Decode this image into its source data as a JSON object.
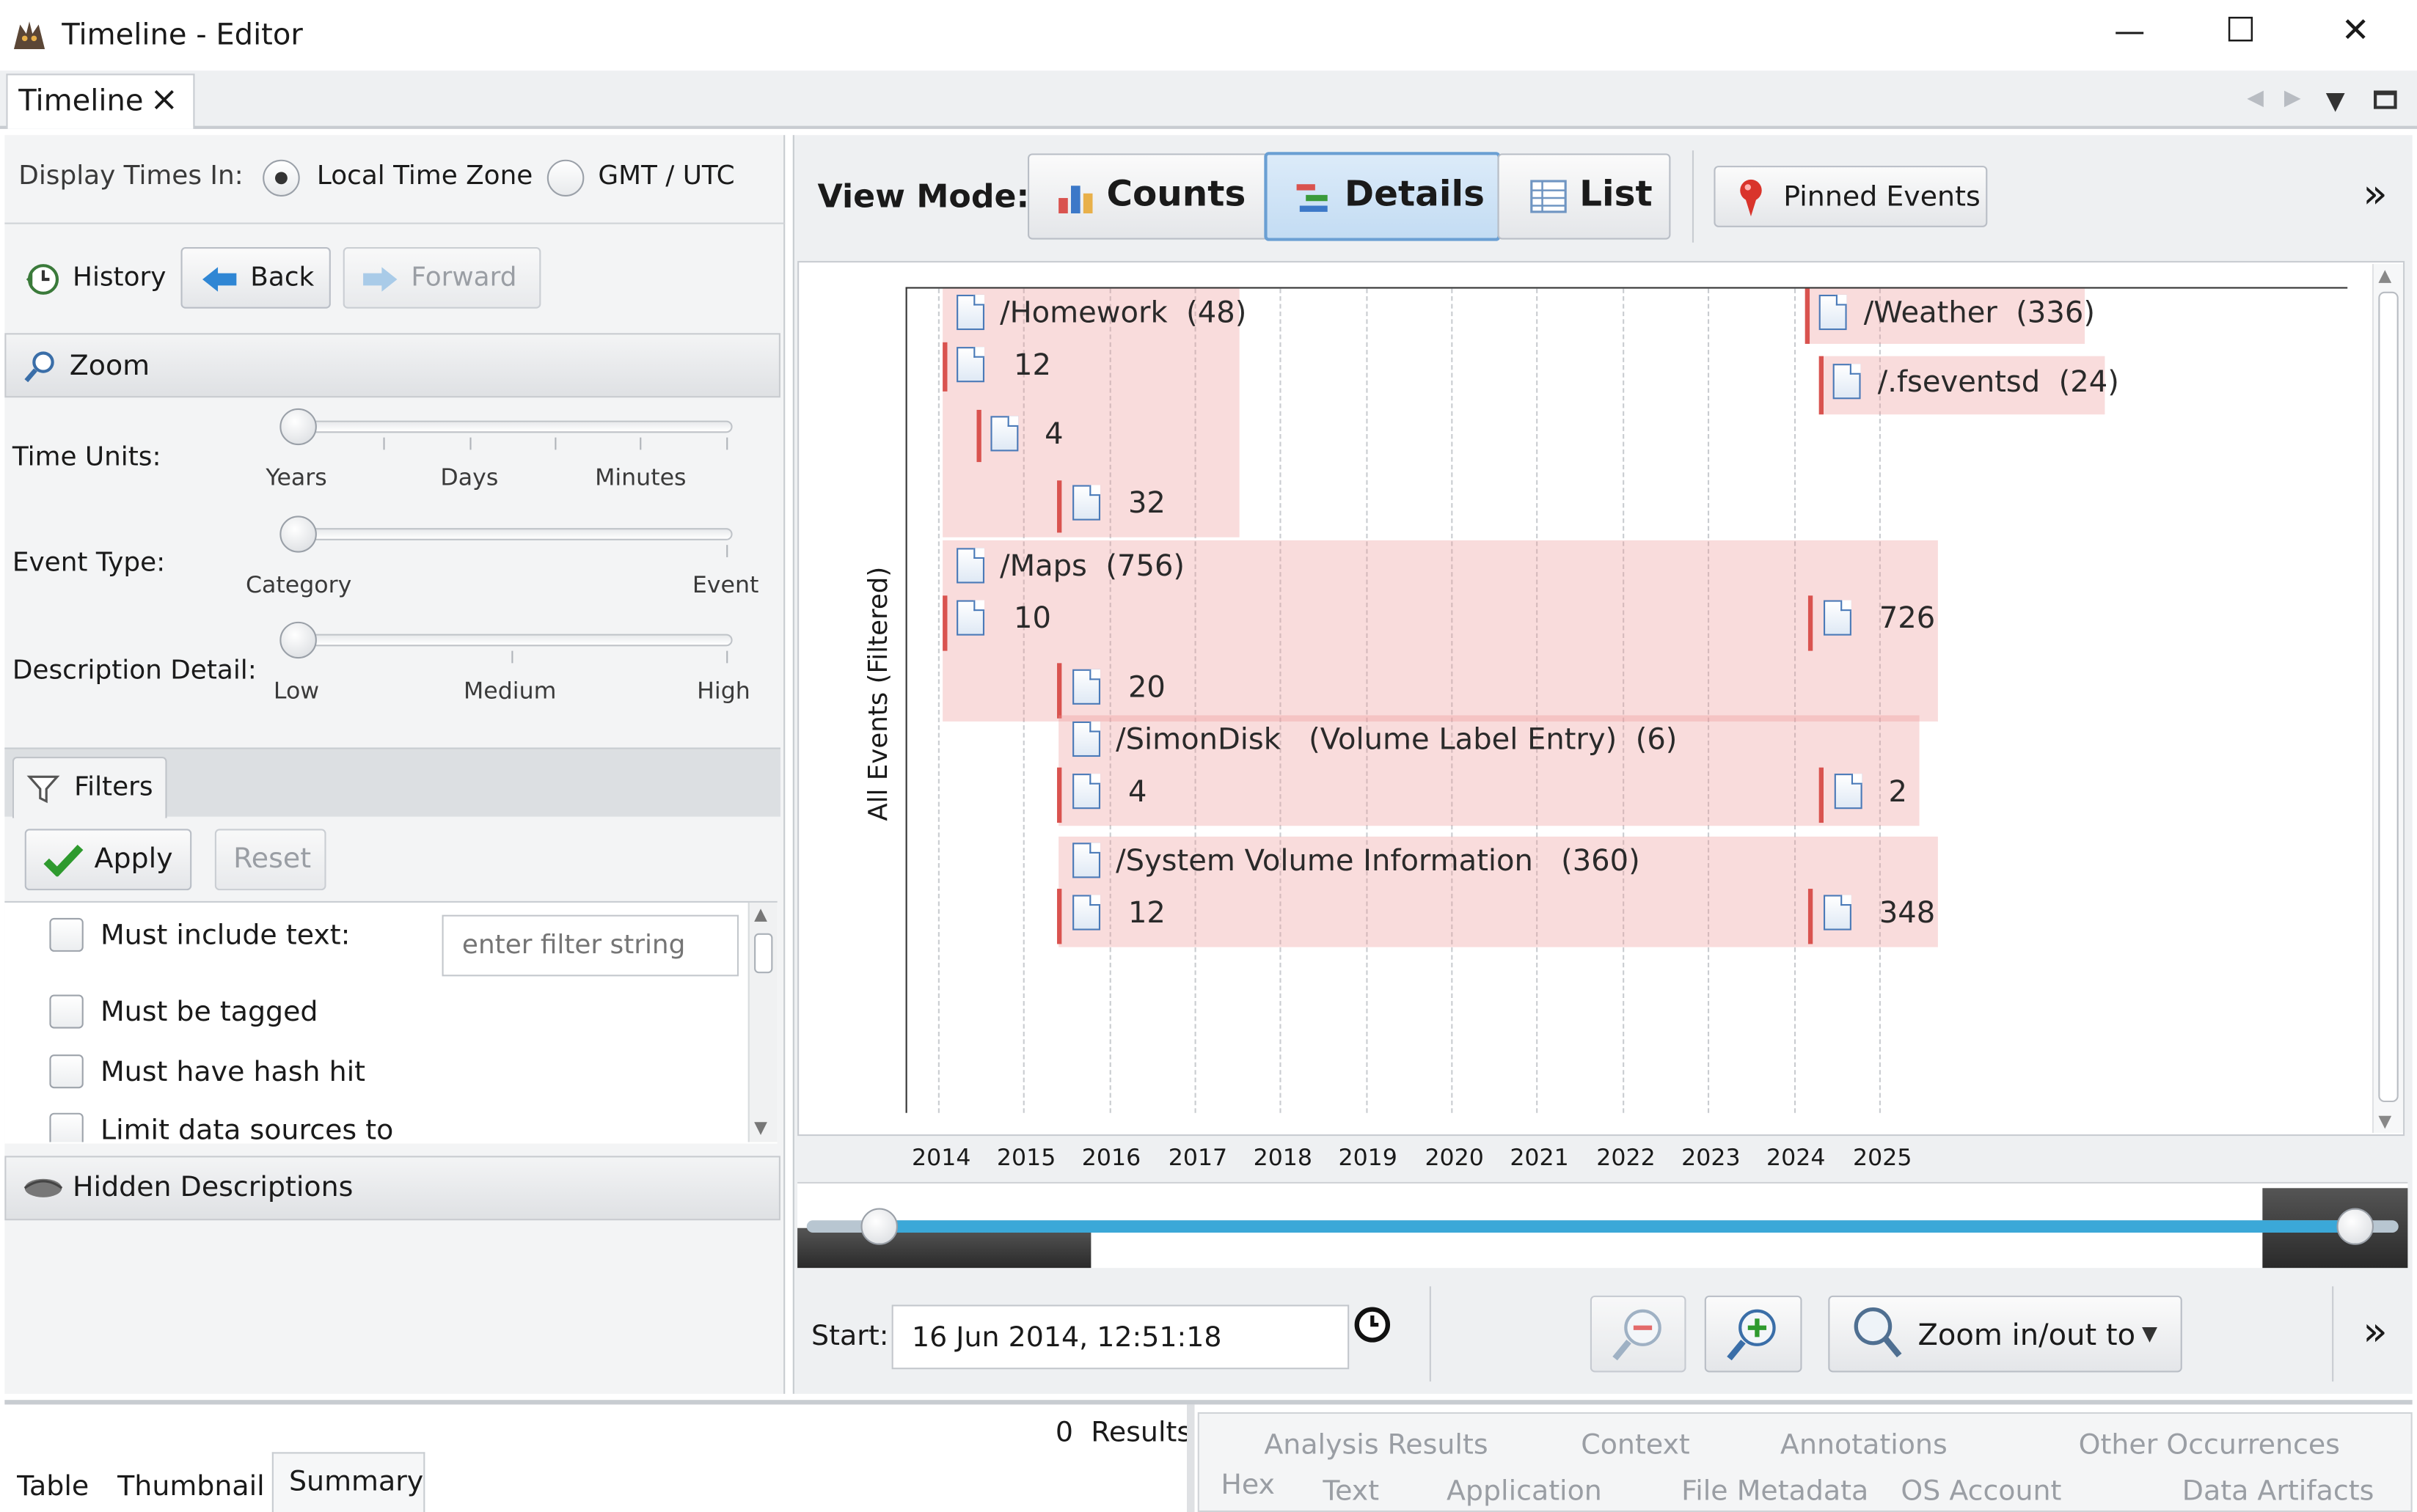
{
  "window": {
    "title": "Timeline - Editor",
    "tab_label": "Timeline",
    "tab_close": "×",
    "min": "—",
    "max": "☐",
    "close": "✕"
  },
  "display_times": {
    "label": "Display Times In:",
    "options": [
      "Local Time Zone",
      "GMT / UTC"
    ],
    "selected": "Local Time Zone"
  },
  "history": {
    "label": "History",
    "back": "Back",
    "forward": "Forward"
  },
  "zoom": {
    "header": "Zoom",
    "time_units": {
      "label": "Time Units:",
      "ticks": [
        "Years",
        "Days",
        "Minutes"
      ],
      "value": "Years"
    },
    "event_type": {
      "label": "Event Type:",
      "ticks": [
        "Category",
        "Event"
      ],
      "value": "Category"
    },
    "description_detail": {
      "label": "Description Detail:",
      "ticks": [
        "Low",
        "Medium",
        "High"
      ],
      "value": "Low"
    }
  },
  "filters": {
    "tab": "Filters",
    "apply": "Apply",
    "reset": "Reset",
    "items": [
      {
        "label": "Must include text:",
        "checked": false
      },
      {
        "label": "Must be tagged",
        "checked": false
      },
      {
        "label": "Must have hash hit",
        "checked": false
      },
      {
        "label": "Limit data sources to",
        "checked": false
      }
    ],
    "text_placeholder": "enter filter string"
  },
  "hidden_descriptions": {
    "label": "Hidden Descriptions"
  },
  "view_mode": {
    "label": "View Mode:",
    "modes": [
      "Counts",
      "Details",
      "List"
    ],
    "selected": "Details",
    "pinned": "Pinned Events",
    "more": "»"
  },
  "chart": {
    "y_axis_label": "All Events (Filtered)",
    "years": [
      "2014",
      "2015",
      "2016",
      "2017",
      "2018",
      "2019",
      "2020",
      "2021",
      "2022",
      "2023",
      "2024",
      "2025"
    ],
    "groups": [
      {
        "name": "/Homework",
        "count": "(48)",
        "subs": [
          "12",
          "4",
          "32"
        ]
      },
      {
        "name": "/Weather",
        "count": "(336)"
      },
      {
        "name": "/.fseventsd",
        "count": "(24)"
      },
      {
        "name": "/Maps",
        "count": "(756)",
        "subs": [
          "10",
          "726",
          "20"
        ]
      },
      {
        "name": "/SimonDisk",
        "extra": "(Volume Label Entry)",
        "count": "(6)",
        "subs": [
          "4",
          "2"
        ]
      },
      {
        "name": "/System Volume Information",
        "count": "(360)",
        "subs": [
          "12",
          "348"
        ]
      }
    ]
  },
  "bottom_toolbar": {
    "start_label": "Start:",
    "start_value": "16 Jun 2014, 12:51:18",
    "zoom_label": "Zoom in/out to",
    "more": "»"
  },
  "results": {
    "count": "0",
    "label": "Results",
    "left_tabs": [
      "Table",
      "Thumbnail",
      "Summary"
    ],
    "selected_left_tab": "Summary",
    "right_tabs_row1": [
      "Analysis Results",
      "Context",
      "Annotations",
      "Other Occurrences"
    ],
    "right_tabs_row2": [
      "Hex",
      "Text",
      "Application",
      "File Metadata",
      "OS Account",
      "Data Artifacts"
    ]
  },
  "colors": {
    "event_fill": "#ec9696",
    "event_bar": "#d9534f",
    "range_slider": "#3ba8d8",
    "selected_mode": "#cfe3f6"
  }
}
